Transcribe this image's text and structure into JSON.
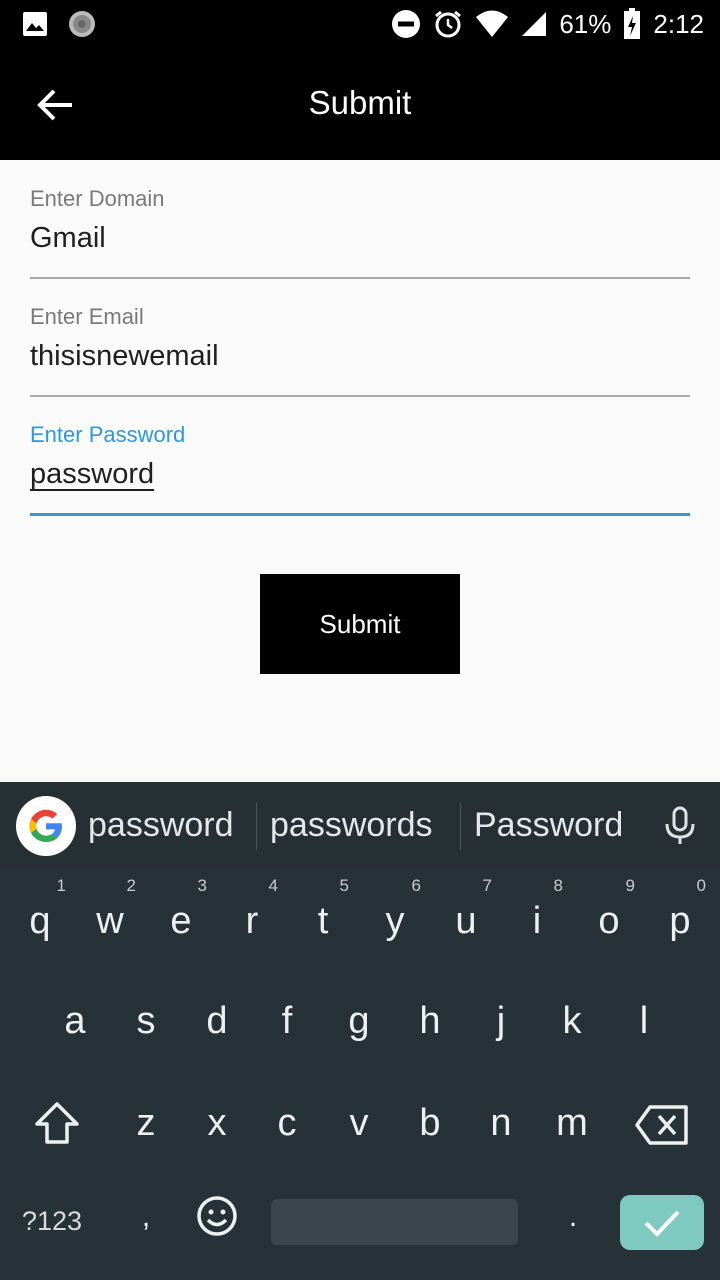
{
  "status_bar": {
    "battery": "61%",
    "time": "2:12"
  },
  "app_bar": {
    "title": "Submit"
  },
  "form": {
    "domain": {
      "label": "Enter Domain",
      "value": "Gmail"
    },
    "email": {
      "label": "Enter Email",
      "value": "thisisnewemail"
    },
    "password": {
      "label": "Enter Password",
      "value": "password"
    },
    "submit_label": "Submit"
  },
  "keyboard": {
    "suggestions": [
      "password",
      "passwords",
      "Password"
    ],
    "row1": [
      "q",
      "w",
      "e",
      "r",
      "t",
      "y",
      "u",
      "i",
      "o",
      "p"
    ],
    "row1_hints": [
      "1",
      "2",
      "3",
      "4",
      "5",
      "6",
      "7",
      "8",
      "9",
      "0"
    ],
    "row2": [
      "a",
      "s",
      "d",
      "f",
      "g",
      "h",
      "j",
      "k",
      "l"
    ],
    "row3": [
      "z",
      "x",
      "c",
      "v",
      "b",
      "n",
      "m"
    ],
    "symbols_label": "?123",
    "comma": ",",
    "period": "."
  },
  "colors": {
    "accent": "#2e97df",
    "keyboard_bg": "#263238",
    "enter_key": "#7fcac0"
  }
}
